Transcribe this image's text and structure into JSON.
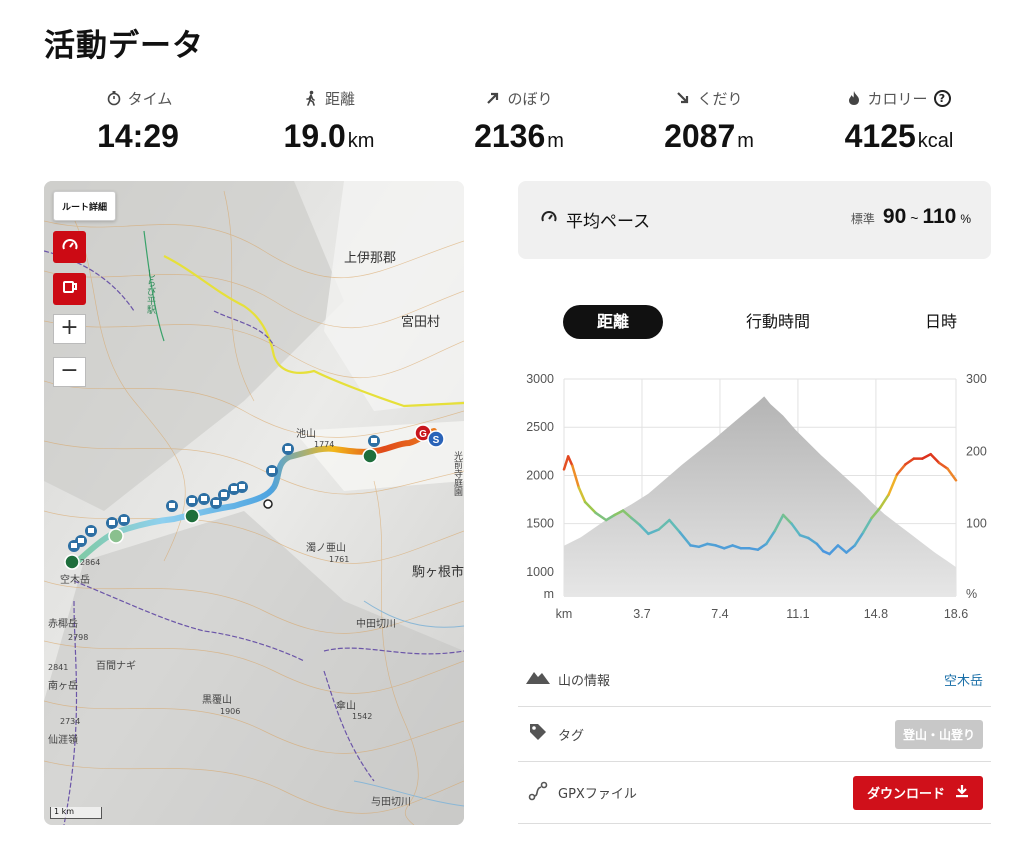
{
  "page": {
    "title": "活動データ"
  },
  "stats": [
    {
      "label": "タイム",
      "value": "14:29",
      "unit": "",
      "icon": "stopwatch-icon"
    },
    {
      "label": "距離",
      "value": "19.0",
      "unit": "km",
      "icon": "walker-icon"
    },
    {
      "label": "のぼり",
      "value": "2136",
      "unit": "m",
      "icon": "arrow-up-right-icon"
    },
    {
      "label": "くだり",
      "value": "2087",
      "unit": "m",
      "icon": "arrow-down-right-icon"
    },
    {
      "label": "カロリー",
      "value": "4125",
      "unit": "kcal",
      "icon": "flame-icon"
    }
  ],
  "map": {
    "route_detail_label": "ルート詳細",
    "zoom_in": "+",
    "zoom_out": "−",
    "scale": "1 km",
    "labels": {
      "kamiina": "上伊那郡",
      "miyada": "宮田村",
      "komagane": "駒ヶ根市",
      "kisokoma": "空木岳",
      "ikeyama": "池山",
      "hyakkennagi": "百間ナギ",
      "kurobiyama": "黒覆山",
      "okibodake": "赤椰岳",
      "nakada": "中田切川",
      "yoda": "与田切川",
      "ikeyama_elev": "1774",
      "mimaekoyama": "濁ノ亜山",
      "mimae_elev": "1761",
      "kisokoma_elev": "2864",
      "okibo_elev": "2798",
      "kurobi_elev": "1906",
      "fu_elev": "1542",
      "fuyama": "傘山",
      "elev2841": "2841",
      "elev2734": "2734",
      "sen": "仙涯嶺",
      "kou": "光前寺庭園",
      "shirabi": "しらび平駅",
      "minami": "南ヶ岳"
    }
  },
  "pace": {
    "label": "平均ペース",
    "standard": "標準",
    "min": "90",
    "tilde": "~",
    "max": "110",
    "unit": "%"
  },
  "tabs": [
    "距離",
    "行動時間",
    "日時"
  ],
  "chart_data": {
    "type": "line",
    "x_ticks": [
      "3.7",
      "7.4",
      "11.1",
      "14.8",
      "18.6"
    ],
    "x_unit_label": "km",
    "y_left_ticks": [
      "3000",
      "2500",
      "2000",
      "1500",
      "1000"
    ],
    "y_left_unit": "m",
    "y_right_ticks": [
      "300",
      "200",
      "100"
    ],
    "y_right_unit": "%",
    "ylim_left": [
      750,
      3000
    ],
    "ylim_right": [
      0,
      300
    ],
    "xlim": [
      0,
      18.6
    ],
    "series": [
      {
        "kind": "elevation-area",
        "x": [
          0,
          0.8,
          1.6,
          2.4,
          3.2,
          4.0,
          4.8,
          5.6,
          6.4,
          7.2,
          8.0,
          8.6,
          9.2,
          9.5,
          9.8,
          10.4,
          11.0,
          11.6,
          12.2,
          12.8,
          13.4,
          14.0,
          14.6,
          15.2,
          15.8,
          16.4,
          17.0,
          17.6,
          18.2,
          18.6
        ],
        "values": [
          1270,
          1360,
          1480,
          1600,
          1700,
          1810,
          1960,
          2110,
          2250,
          2390,
          2540,
          2650,
          2760,
          2820,
          2740,
          2620,
          2470,
          2340,
          2210,
          2090,
          1970,
          1850,
          1720,
          1600,
          1500,
          1400,
          1300,
          1200,
          1110,
          1050
        ]
      },
      {
        "kind": "pace-line",
        "x": [
          0,
          0.2,
          0.4,
          0.7,
          1.0,
          1.5,
          2.0,
          2.4,
          2.8,
          3.2,
          3.6,
          4.0,
          4.5,
          5.0,
          5.5,
          6.0,
          6.4,
          6.8,
          7.2,
          7.6,
          8.0,
          8.4,
          8.8,
          9.2,
          9.6,
          10.0,
          10.4,
          10.8,
          11.2,
          11.6,
          12.0,
          12.3,
          12.6,
          13.0,
          13.4,
          13.8,
          14.2,
          14.6,
          15.0,
          15.4,
          15.8,
          16.2,
          16.6,
          17.0,
          17.4,
          17.8,
          18.2,
          18.6
        ],
        "values": [
          175,
          193,
          180,
          150,
          130,
          115,
          105,
          112,
          118,
          108,
          98,
          86,
          92,
          105,
          88,
          70,
          68,
          72,
          70,
          66,
          70,
          66,
          66,
          64,
          72,
          90,
          112,
          100,
          84,
          80,
          72,
          62,
          58,
          70,
          60,
          70,
          88,
          108,
          122,
          140,
          168,
          182,
          190,
          190,
          196,
          184,
          176,
          160
        ]
      }
    ]
  },
  "info": {
    "mountain": {
      "label": "山の情報",
      "value": "空木岳"
    },
    "tag": {
      "label": "タグ",
      "value": "登山・山登り"
    },
    "gpx": {
      "label": "GPXファイル",
      "button": "ダウンロード"
    }
  }
}
